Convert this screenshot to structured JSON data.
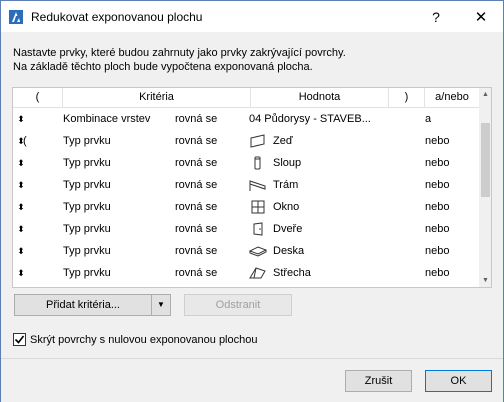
{
  "dialog": {
    "title": "Redukovat exponovanou plochu",
    "help": "?",
    "close": "✕"
  },
  "description": {
    "line1": "Nastavte prvky, které budou zahrnuty jako prvky zakrývající povrchy.",
    "line2": "Na základě těchto ploch bude vypočtena exponovaná plocha."
  },
  "table": {
    "headers": {
      "open_paren": "(",
      "criteria": "Kritéria",
      "value": "Hodnota",
      "close_paren": ")",
      "andor": "a/nebo"
    },
    "rows": [
      {
        "handle": "⬍",
        "paren": "",
        "criteria": "Kombinace vrstev",
        "operator": "rovná se",
        "icon": "",
        "value": "04 Půdorysy - STAVEB...",
        "andor": "a"
      },
      {
        "handle": "⬍",
        "paren": "(",
        "criteria": "Typ prvku",
        "operator": "rovná se",
        "icon": "wall-icon",
        "value": "Zeď",
        "andor": "nebo"
      },
      {
        "handle": "⬍",
        "paren": "",
        "criteria": "Typ prvku",
        "operator": "rovná se",
        "icon": "column-icon",
        "value": "Sloup",
        "andor": "nebo"
      },
      {
        "handle": "⬍",
        "paren": "",
        "criteria": "Typ prvku",
        "operator": "rovná se",
        "icon": "beam-icon",
        "value": "Trám",
        "andor": "nebo"
      },
      {
        "handle": "⬍",
        "paren": "",
        "criteria": "Typ prvku",
        "operator": "rovná se",
        "icon": "window-icon",
        "value": "Okno",
        "andor": "nebo"
      },
      {
        "handle": "⬍",
        "paren": "",
        "criteria": "Typ prvku",
        "operator": "rovná se",
        "icon": "door-icon",
        "value": "Dveře",
        "andor": "nebo"
      },
      {
        "handle": "⬍",
        "paren": "",
        "criteria": "Typ prvku",
        "operator": "rovná se",
        "icon": "slab-icon",
        "value": "Deska",
        "andor": "nebo"
      },
      {
        "handle": "⬍",
        "paren": "",
        "criteria": "Typ prvku",
        "operator": "rovná se",
        "icon": "roof-icon",
        "value": "Střecha",
        "andor": "nebo"
      }
    ]
  },
  "buttons": {
    "add_criteria": "Přidat kritéria...",
    "remove": "Odstranit",
    "cancel": "Zrušit",
    "ok": "OK"
  },
  "checkbox": {
    "label": "Skrýt povrchy s nulovou exponovanou plochou",
    "checked": true
  }
}
